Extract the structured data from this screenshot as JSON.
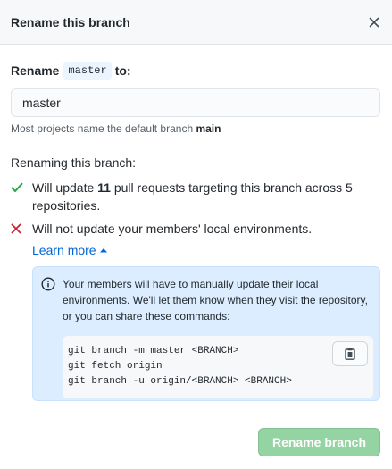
{
  "dialog": {
    "title": "Rename this branch",
    "close_icon": "x-icon"
  },
  "form": {
    "label_prefix": "Rename",
    "branch_name": "master",
    "label_suffix": "to:",
    "input_value": "master",
    "hint_prefix": "Most projects name the default branch ",
    "hint_default": "main"
  },
  "effects": {
    "section_title": "Renaming this branch:",
    "items": [
      {
        "icon": "check-icon",
        "color": "#28a745",
        "prefix": "Will update ",
        "count": "11",
        "suffix": " pull requests targeting this branch across 5 repositories."
      },
      {
        "icon": "x-icon",
        "color": "#cb2431",
        "text": "Will not update your members' local environments."
      }
    ],
    "learn_more": "Learn more",
    "learn_more_icon": "triangle-up-icon"
  },
  "info": {
    "icon": "info-icon",
    "text": "Your members will have to manually update their local environments. We'll let them know when they visit the repository, or you can share these commands:",
    "commands": [
      "git branch -m master <BRANCH>",
      "git fetch origin",
      "git branch -u origin/<BRANCH> <BRANCH>"
    ],
    "copy_icon": "clipboard-icon"
  },
  "footer": {
    "submit_label": "Rename branch"
  },
  "colors": {
    "accent": "#0366d6",
    "success": "#28a745",
    "danger": "#cb2431",
    "button_disabled": "#94d3a2",
    "info_bg": "#dbedff"
  }
}
